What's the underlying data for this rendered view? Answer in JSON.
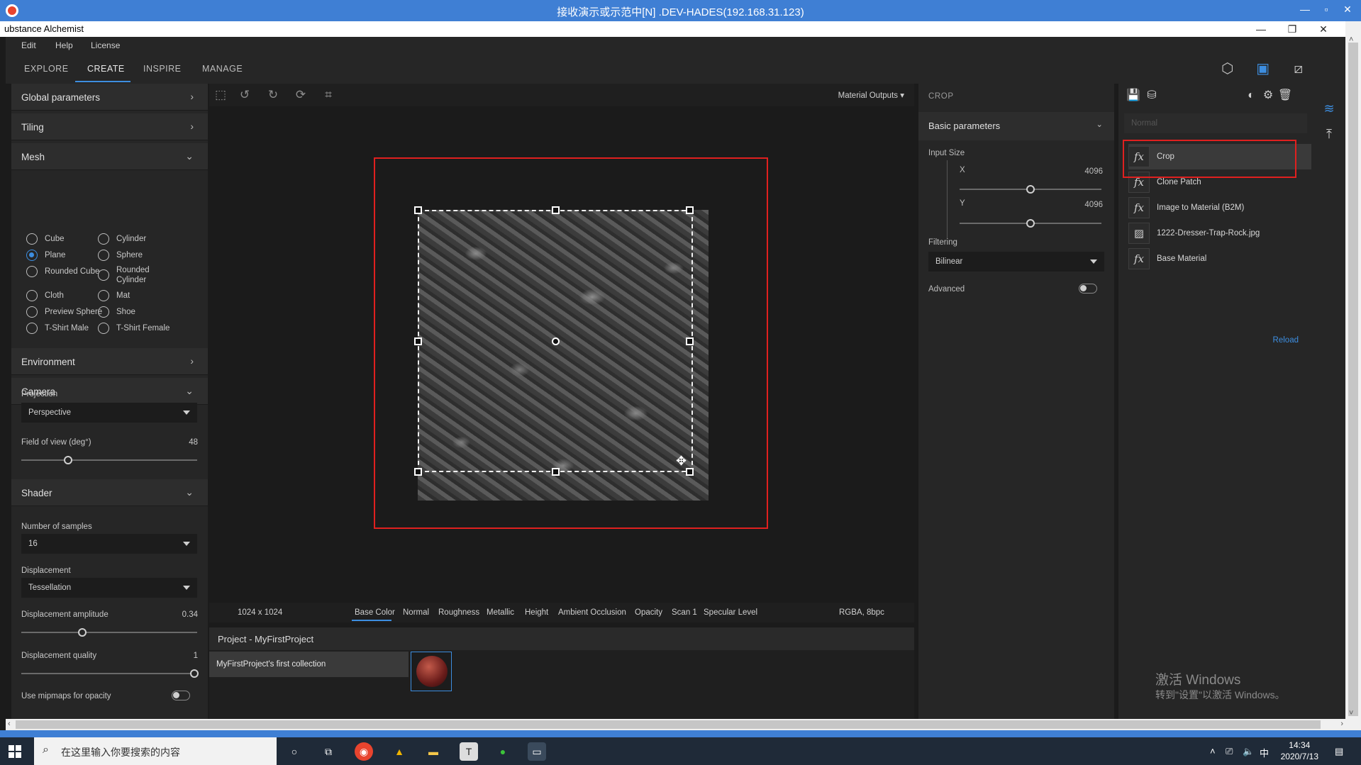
{
  "remote": {
    "title": "接收演示或示范中[N] .DEV-HADES(192.168.31.123)"
  },
  "app": {
    "title": "ubstance Alchemist"
  },
  "menu": {
    "items": [
      "Edit",
      "Help",
      "License"
    ]
  },
  "tabs": [
    "EXPLORE",
    "CREATE",
    "INSPIRE",
    "MANAGE"
  ],
  "left": {
    "global": "Global parameters",
    "tiling": "Tiling",
    "mesh": {
      "title": "Mesh",
      "options": [
        "Cube",
        "Cylinder",
        "Plane",
        "Sphere",
        "Rounded Cube",
        "Rounded Cylinder",
        "Cloth",
        "Mat",
        "Preview Sphere",
        "Shoe",
        "T-Shirt Male",
        "T-Shirt Female"
      ],
      "selected": "Plane"
    },
    "environment": "Environment",
    "camera": {
      "title": "Camera",
      "projection_label": "Projection",
      "projection": "Perspective",
      "fov_label": "Field of view (deg°)",
      "fov": "48"
    },
    "shader": {
      "title": "Shader",
      "samples_label": "Number of samples",
      "samples": "16",
      "displacement_label": "Displacement",
      "displacement": "Tessellation",
      "amp_label": "Displacement amplitude",
      "amp": "0.34",
      "quality_label": "Displacement quality",
      "quality": "1",
      "mipmaps_label": "Use mipmaps for opacity"
    }
  },
  "viewport": {
    "outputs_label": "Material Outputs",
    "resolution": "1024 x 1024",
    "channels": [
      "Base Color",
      "Normal",
      "Roughness",
      "Metallic",
      "Height",
      "Ambient Occlusion",
      "Opacity",
      "Scan 1",
      "Specular Level"
    ],
    "active_channel": "Base Color",
    "format": "RGBA, 8bpc"
  },
  "project": {
    "title": "Project - MyFirstProject",
    "collection": "MyFirstProject's first collection"
  },
  "crop": {
    "header": "CROP",
    "basic": "Basic parameters",
    "input_size": "Input Size",
    "x_label": "X",
    "x_value": "4096",
    "y_label": "Y",
    "y_value": "4096",
    "filtering_label": "Filtering",
    "filtering": "Bilinear",
    "advanced": "Advanced"
  },
  "layers": {
    "blend": "Normal",
    "items": [
      {
        "name": "Crop",
        "icon": "fx-icon"
      },
      {
        "name": "Clone Patch",
        "icon": "fx-icon"
      },
      {
        "name": "Image to Material (B2M)",
        "icon": "fx-icon"
      },
      {
        "name": "1222-Dresser-Trap-Rock.jpg",
        "icon": "image-icon"
      },
      {
        "name": "Base Material",
        "icon": "fx-icon"
      }
    ],
    "reload": "Reload"
  },
  "watermark": {
    "line1": "激活 Windows",
    "line2": "转到\"设置\"以激活 Windows。"
  },
  "taskbar": {
    "search_placeholder": "在这里输入你要搜索的内容",
    "time": "14:34",
    "date": "2020/7/13",
    "ime": "中"
  },
  "colors": {
    "accent": "#3d8ee0",
    "highlight": "#e0201f"
  }
}
